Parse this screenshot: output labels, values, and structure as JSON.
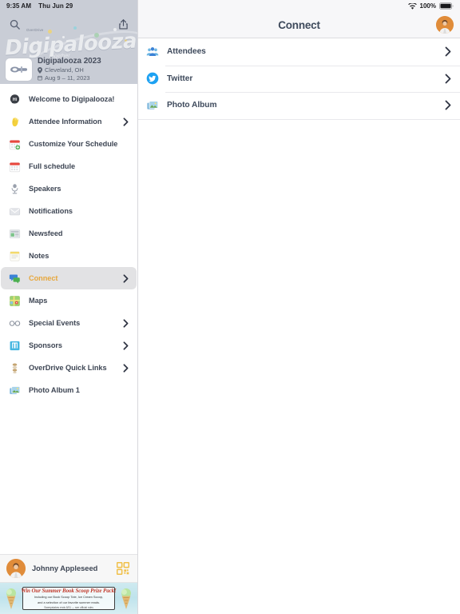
{
  "status_bar": {
    "time": "9:35 AM",
    "date": "Thu Jun 29",
    "wifi_icon": "wifi-icon",
    "battery_percent": "100%",
    "battery_icon": "battery-full-icon"
  },
  "sidebar": {
    "header": {
      "search_icon": "search-icon",
      "share_icon": "share-icon",
      "artwork_word": "Digipalooza",
      "artwork_tagline": "together",
      "artwork_caption": "OverDrive",
      "event_thumbnail": "event-logo-thumbnail",
      "event_title": "Digipalooza 2023",
      "location_icon": "location-pin-icon",
      "location": "Cleveland, OH",
      "calendar_icon": "calendar-icon",
      "dates": "Aug 9 – 11, 2023"
    },
    "items": [
      {
        "label": "Welcome to Digipalooza!",
        "icon": "hi-badge-icon",
        "chevron": false,
        "selected": false
      },
      {
        "label": "Attendee Information",
        "icon": "waving-hand-icon",
        "chevron": true,
        "selected": false
      },
      {
        "label": "Customize Your Schedule",
        "icon": "calendar-add-icon",
        "chevron": false,
        "selected": false
      },
      {
        "label": "Full schedule",
        "icon": "calendar-icon",
        "chevron": false,
        "selected": false
      },
      {
        "label": "Speakers",
        "icon": "microphone-icon",
        "chevron": false,
        "selected": false
      },
      {
        "label": "Notifications",
        "icon": "envelope-icon",
        "chevron": false,
        "selected": false
      },
      {
        "label": "Newsfeed",
        "icon": "newspaper-icon",
        "chevron": false,
        "selected": false
      },
      {
        "label": "Notes",
        "icon": "notes-icon",
        "chevron": false,
        "selected": false
      },
      {
        "label": "Connect",
        "icon": "speech-bubbles-icon",
        "chevron": true,
        "selected": true
      },
      {
        "label": "Maps",
        "icon": "map-icon",
        "chevron": false,
        "selected": false
      },
      {
        "label": "Special Events",
        "icon": "glasses-icon",
        "chevron": true,
        "selected": false
      },
      {
        "label": "Sponsors",
        "icon": "building-icon",
        "chevron": true,
        "selected": false
      },
      {
        "label": "OverDrive Quick Links",
        "icon": "overdrive-stack-icon",
        "chevron": true,
        "selected": false
      },
      {
        "label": "Photo Album 1",
        "icon": "photo-icon",
        "chevron": false,
        "selected": false
      }
    ],
    "footer": {
      "avatar": "user-avatar",
      "user_name": "Johnny Appleseed",
      "qr_icon": "qr-code-icon"
    },
    "ad": {
      "headline": "Win Our Summer Book Scoop Prize Pack!",
      "subline_1": "Including our Book Scoop Tote, Ice Cream Scoop,",
      "subline_2": "and a selection of our favorite summer reads.",
      "footer_text": "Sweepstakes ends 8/31 — see official rules",
      "left_icon": "ice-cream-cone-icon",
      "right_icon": "ice-cream-cone-icon"
    }
  },
  "main": {
    "title": "Connect",
    "avatar": "user-avatar",
    "rows": [
      {
        "label": "Attendees",
        "icon": "attendees-icon",
        "chevron": "chevron-right-icon"
      },
      {
        "label": "Twitter",
        "icon": "twitter-icon",
        "chevron": "chevron-right-icon"
      },
      {
        "label": "Photo Album",
        "icon": "photo-album-icon",
        "chevron": "chevron-right-icon"
      }
    ]
  },
  "colors": {
    "accent_selected": "#e7a83e",
    "text_primary": "#3e4a5c",
    "nav_bg": "#f7f7f9",
    "header_bg": "#c9cdd6",
    "selected_row_bg": "#e2e2e4",
    "twitter_blue": "#1da1f2"
  }
}
